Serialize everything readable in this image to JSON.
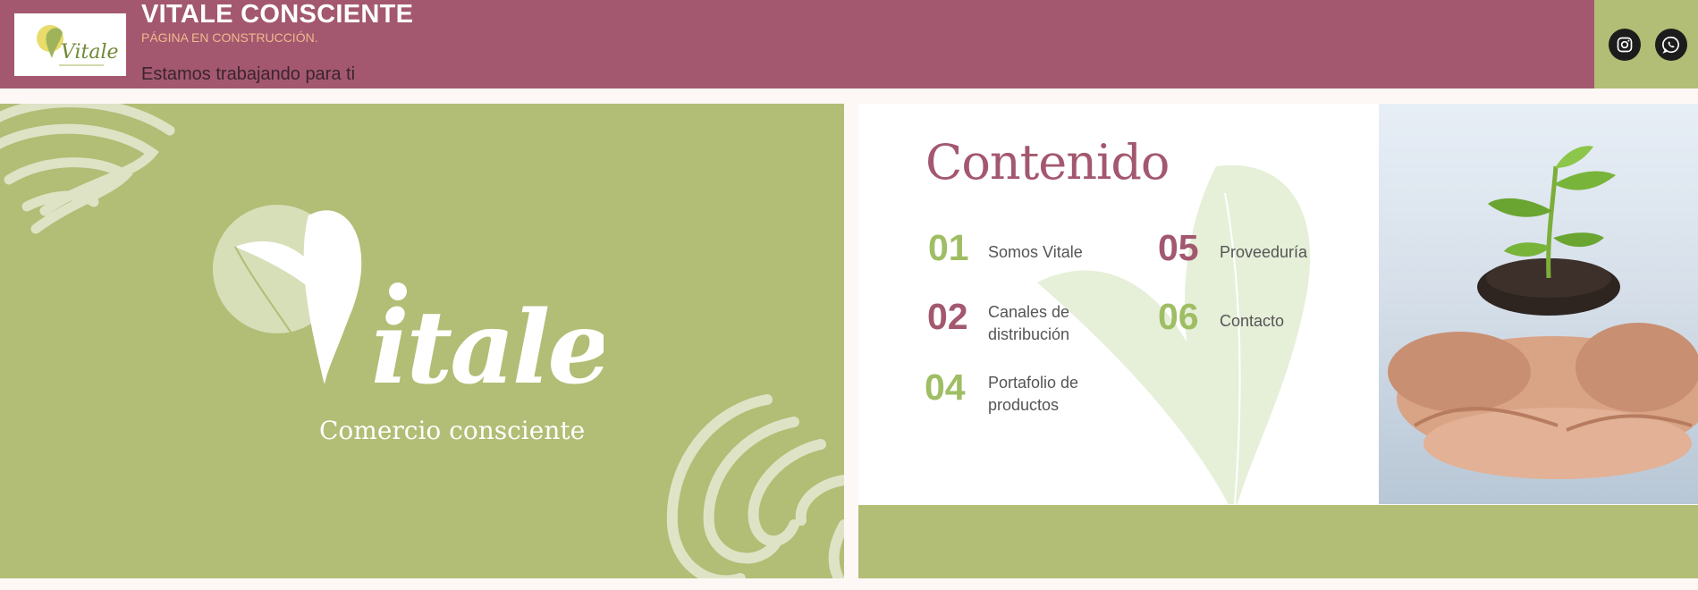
{
  "header": {
    "title": "VITALE CONSCIENTE",
    "subtitle": "PÁGINA EN CONSTRUCCIÓN.",
    "tagline": "Estamos trabajando para ti",
    "logo_text": "Vitale",
    "social": [
      {
        "name": "instagram",
        "icon": "instagram-icon"
      },
      {
        "name": "whatsapp",
        "icon": "whatsapp-icon"
      }
    ]
  },
  "hero": {
    "brand": "Vitale",
    "tagline": "Comercio consciente"
  },
  "contents": {
    "title": "Contenido",
    "items": [
      {
        "num": "01",
        "label": "Somos Vitale"
      },
      {
        "num": "02",
        "label": "Canales de distribución"
      },
      {
        "num": "04",
        "label": "Portafolio de productos"
      },
      {
        "num": "05",
        "label": "Proveeduría"
      },
      {
        "num": "06",
        "label": "Contacto"
      }
    ]
  },
  "colors": {
    "header_bg": "#a3586f",
    "green": "#b2bd75",
    "accent_orange": "#f0b98d",
    "number_green": "#9fbe64"
  }
}
